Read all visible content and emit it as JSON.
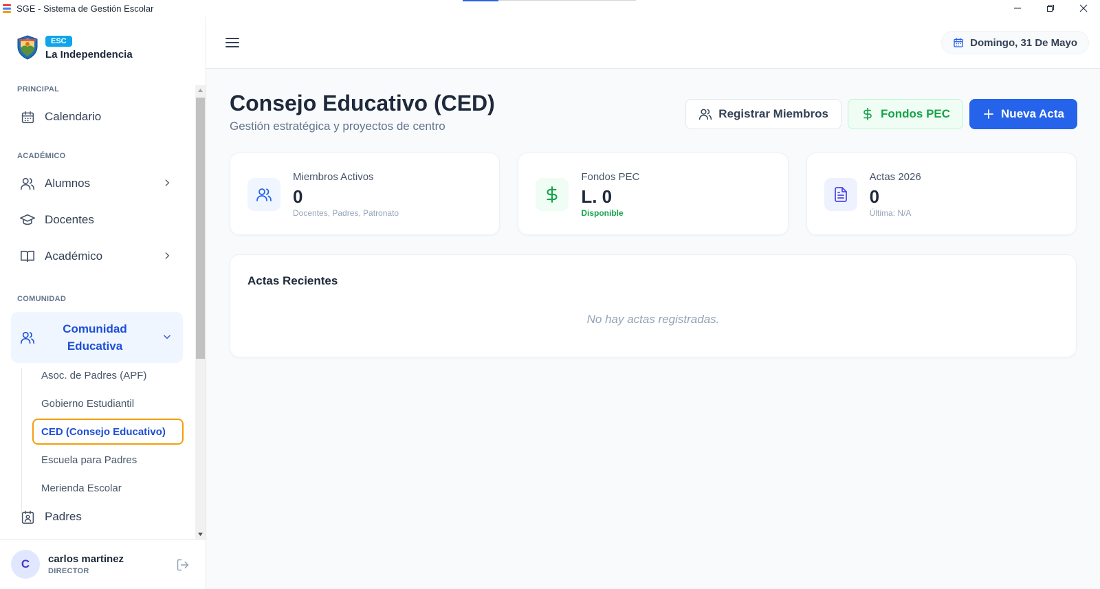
{
  "window": {
    "title": "SGE - Sistema de Gestión Escolar"
  },
  "brand": {
    "badge": "ESC",
    "school": "La Independencia"
  },
  "sidebar": {
    "sections": {
      "principal": "PRINCIPAL",
      "academico": "ACADÉMICO",
      "comunidad": "COMUNIDAD"
    },
    "items": {
      "calendario": "Calendario",
      "alumnos": "Alumnos",
      "docentes": "Docentes",
      "academico": "Académico",
      "comunidad": "Comunidad Educativa",
      "padres": "Padres"
    },
    "subitems": [
      "Asoc. de Padres (APF)",
      "Gobierno Estudiantil",
      "CED (Consejo Educativo)",
      "Escuela para Padres",
      "Merienda Escolar"
    ]
  },
  "user": {
    "initial": "C",
    "name": "carlos martinez",
    "role": "DIRECTOR"
  },
  "header": {
    "date": "Domingo, 31 De Mayo"
  },
  "page": {
    "title": "Consejo Educativo (CED)",
    "subtitle": "Gestión estratégica y proyectos de centro"
  },
  "actions": {
    "register": "Registrar Miembros",
    "funds": "Fondos PEC",
    "new": "Nueva Acta"
  },
  "stats": [
    {
      "label": "Miembros Activos",
      "value": "0",
      "sub": "Docentes, Padres, Patronato"
    },
    {
      "label": "Fondos PEC",
      "value": "L. 0",
      "sub": "Disponible"
    },
    {
      "label": "Actas 2026",
      "value": "0",
      "sub": "Última: N/A"
    }
  ],
  "recent": {
    "title": "Actas Recientes",
    "empty": "No hay actas registradas."
  },
  "colors": {
    "primary": "#2563eb",
    "success": "#16a34a",
    "accent_outline": "#f59e0b",
    "badge": "#0ea5e9"
  }
}
